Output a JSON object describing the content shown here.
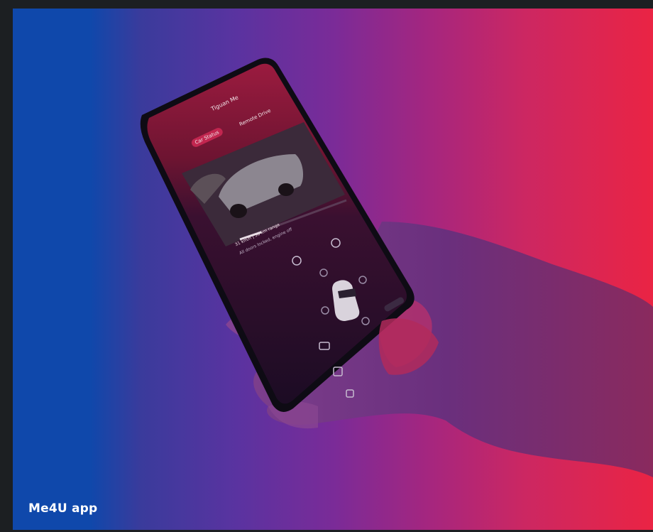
{
  "caption": {
    "text": "Me4U app"
  },
  "phone_screen": {
    "title": "Tiguan Me",
    "tabs": [
      "Car Status",
      "Remote Drive"
    ],
    "status_line_1": "31 km/h | 56 km range",
    "status_line_2": "All doors locked, engine off"
  },
  "colors": {
    "gradient_left": "#0f48ab",
    "gradient_right": "#ea2444",
    "caption_text": "#ffffff"
  }
}
